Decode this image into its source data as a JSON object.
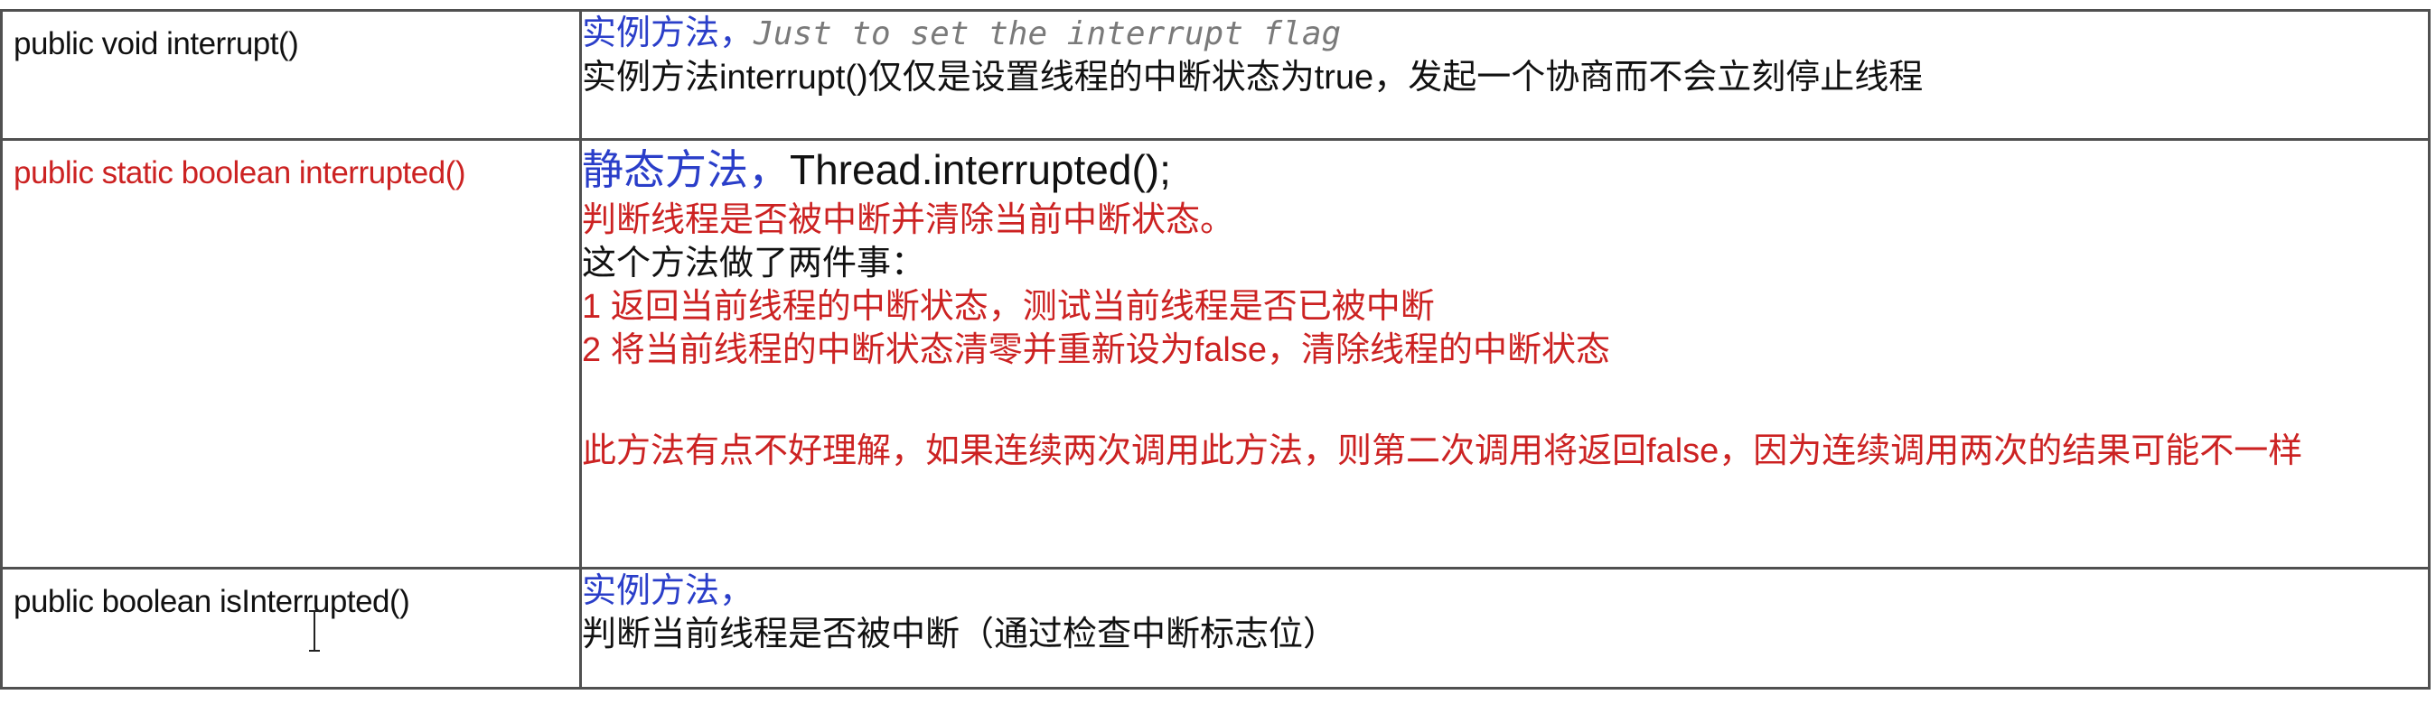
{
  "rows": [
    {
      "method": "public void interrupt()",
      "lines": [
        {
          "prefix": "实例方法，",
          "text": "Just to set the interrupt flag"
        },
        {
          "text": "实例方法interrupt()仅仅是设置线程的中断状态为true，发起一个协商而不会立刻停止线程"
        }
      ]
    },
    {
      "method": "public static boolean interrupted()",
      "lines": [
        {
          "prefix": "静态方法，",
          "text": "Thread.interrupted();"
        },
        {
          "text": "判断线程是否被中断并清除当前中断状态。"
        },
        {
          "text": "这个方法做了两件事："
        },
        {
          "text": "1 返回当前线程的中断状态，测试当前线程是否已被中断"
        },
        {
          "text": "2 将当前线程的中断状态清零并重新设为false，清除线程的中断状态"
        },
        {
          "text": "此方法有点不好理解，如果连续两次调用此方法，则第二次调用将返回false，因为连续调用两次的结果可能不一样"
        }
      ]
    },
    {
      "method": "public boolean isInterrupted()",
      "lines": [
        {
          "text": "实例方法，"
        },
        {
          "text": "判断当前线程是否被中断（通过检查中断标志位）"
        }
      ]
    }
  ],
  "colors": {
    "blue": "#2a3ec9",
    "red": "#cc2222",
    "border": "#505050"
  },
  "icons": {
    "cursor": "text-cursor-icon"
  }
}
